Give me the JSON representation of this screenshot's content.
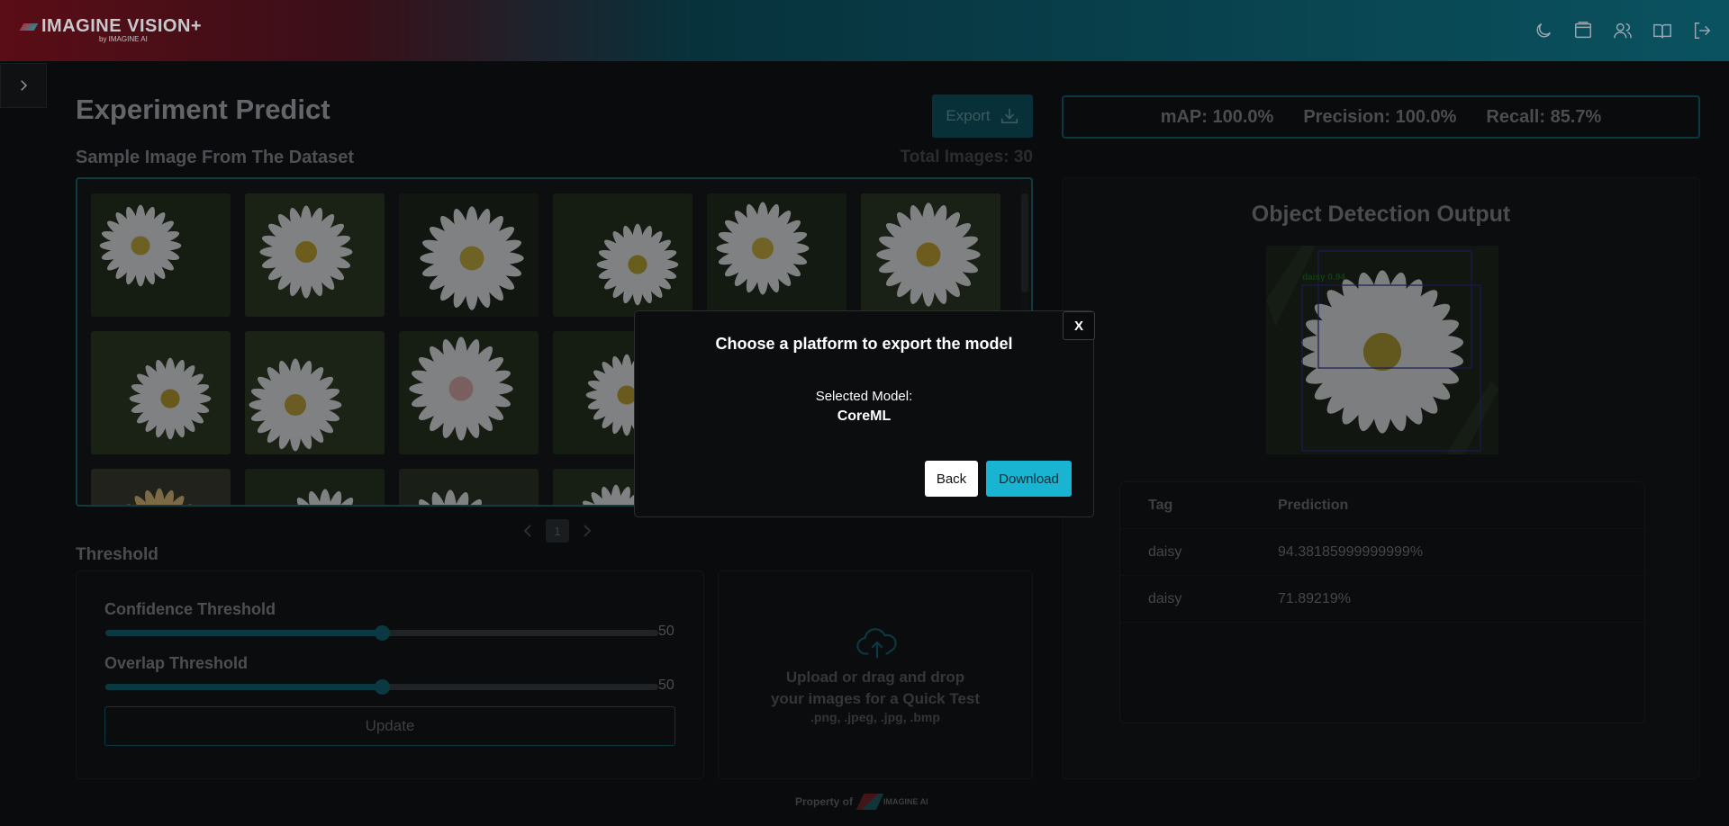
{
  "header": {
    "brand": "IMAGINE VISION+",
    "sub": "by IMAGINE AI",
    "icons": [
      "moon-icon",
      "window-icon",
      "users-icon",
      "book-icon",
      "logout-icon"
    ]
  },
  "page": {
    "title": "Experiment Predict",
    "export_label": "Export",
    "sample_label": "Sample Image From The Dataset",
    "total_images": "Total Images: 30",
    "pagination": {
      "current": "1"
    }
  },
  "threshold": {
    "section_label": "Threshold",
    "confidence": {
      "label": "Confidence Threshold",
      "value": "50",
      "fraction": 0.5
    },
    "overlap": {
      "label": "Overlap Threshold",
      "value": "50",
      "fraction": 0.5
    },
    "update_label": "Update"
  },
  "upload": {
    "line1": "Upload or drag and drop",
    "line2": "your images for a Quick Test",
    "types": ".png, .jpeg, .jpg, .bmp"
  },
  "metrics": {
    "map": "mAP: 100.0%",
    "precision": "Precision: 100.0%",
    "recall": "Recall: 85.7%"
  },
  "output": {
    "title": "Object Detection Output",
    "det_label": "daisy 0.94",
    "table": {
      "headers": [
        "Tag",
        "Prediction"
      ],
      "rows": [
        {
          "tag": "daisy",
          "prediction": "94.38185999999999%"
        },
        {
          "tag": "daisy",
          "prediction": "71.89219%"
        }
      ]
    }
  },
  "footer": {
    "property_of": "Property of",
    "brand": "IMAGINE AI"
  },
  "modal": {
    "close_label": "X",
    "title": "Choose a platform to export the model",
    "selected_label": "Selected Model:",
    "selected_value": "CoreML",
    "back_label": "Back",
    "download_label": "Download"
  },
  "colors": {
    "accent": "#18b4d1",
    "teal_dark": "#0e6773",
    "header_red": "#5a0d16",
    "header_teal": "#0a5260"
  }
}
